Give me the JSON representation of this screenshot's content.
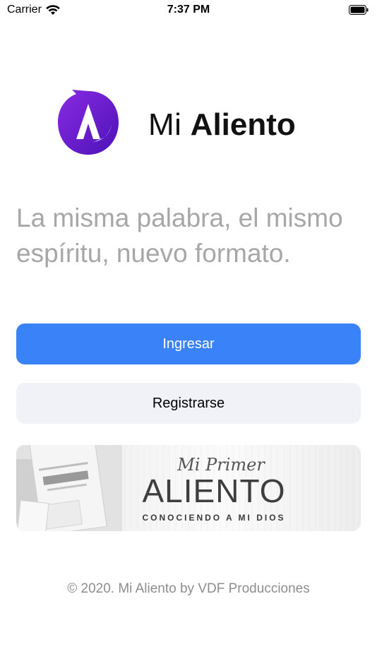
{
  "status_bar": {
    "carrier": "Carrier",
    "time": "7:37 PM",
    "wifi_icon": "wifi-icon",
    "battery_icon": "battery-icon"
  },
  "logo": {
    "icon": "app-logo-icon",
    "name_light": "Mi",
    "name_bold": "Aliento",
    "colors": {
      "purple": "#7b1fe0",
      "violet": "#5b16c9",
      "white": "#ffffff"
    }
  },
  "tagline": "La misma palabra, el mismo espíritu, nuevo formato.",
  "buttons": {
    "login_label": "Ingresar",
    "register_label": "Registrarse",
    "login_color": "#3a82f7",
    "register_color": "#f1f2f7"
  },
  "banner": {
    "script_text": "Mi Primer",
    "title": "ALIENTO",
    "subtitle": "CONOCIENDO A MI DIOS"
  },
  "footer": "© 2020. Mi Aliento by VDF Producciones"
}
